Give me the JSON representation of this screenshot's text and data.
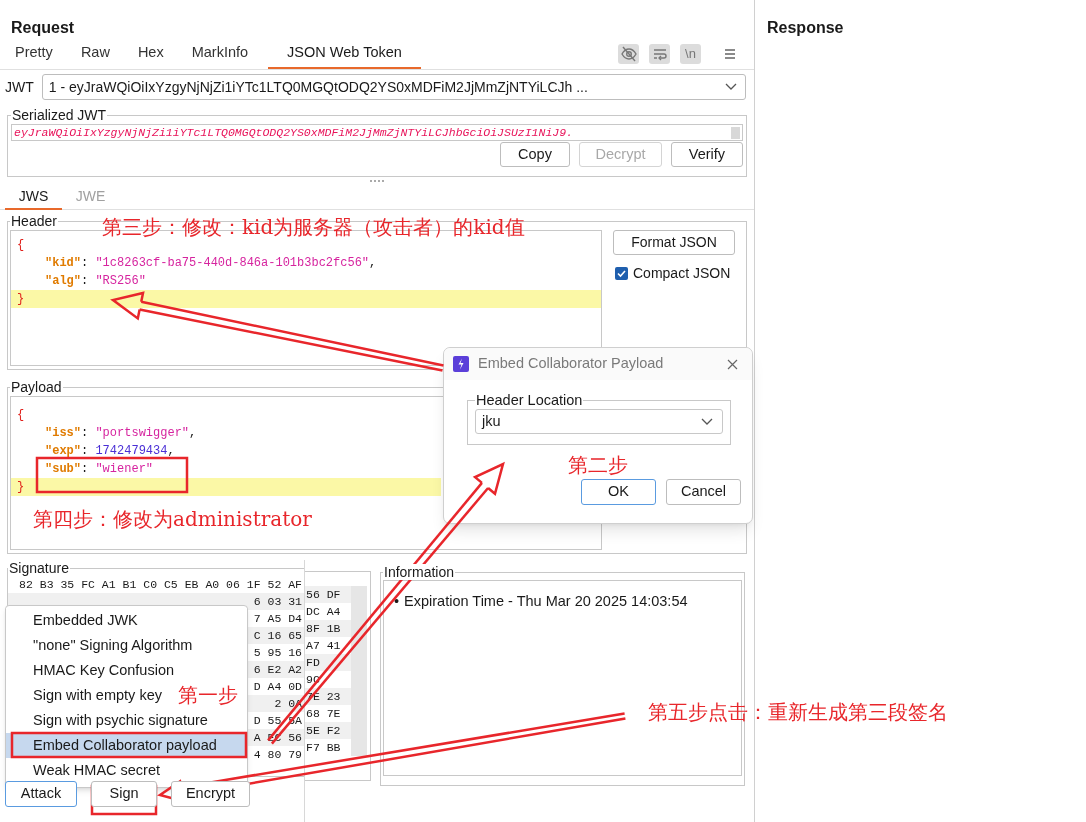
{
  "request": {
    "title": "Request",
    "tabs": [
      {
        "label": "Pretty",
        "selected": false
      },
      {
        "label": "Raw",
        "selected": false
      },
      {
        "label": "Hex",
        "selected": false
      },
      {
        "label": "MarkInfo",
        "selected": false
      },
      {
        "label": "JSON Web Token",
        "selected": true
      }
    ],
    "toolbar": [
      {
        "kind": "hide",
        "on": true
      },
      {
        "kind": "wrap",
        "on": true
      },
      {
        "kind": "newline",
        "label": "\\n",
        "on": true
      },
      {
        "kind": "menu",
        "on": false
      }
    ]
  },
  "jwt_selector": {
    "label": "JWT",
    "value": "1 - eyJraWQiOiIxYzgyNjNjZi1iYTc1LTQ0MGQtODQ2YS0xMDFiM2JjMmZjNTYiLCJh ..."
  },
  "serialized_jwt": {
    "title": "Serialized JWT",
    "value": "eyJraWQiOiIxYzgyNjNjZi1iYTc1LTQ0MGQtODQ2YS0xMDFiM2JjMmZjNTYiLCJhbGciOiJSUzI1NiJ9.",
    "buttons": [
      {
        "label": "Copy",
        "disabled": false
      },
      {
        "label": "Decrypt",
        "disabled": true
      },
      {
        "label": "Verify",
        "disabled": false
      }
    ]
  },
  "token_tabs": [
    {
      "label": "JWS",
      "selected": true
    },
    {
      "label": "JWE",
      "selected": false
    }
  ],
  "header": {
    "title": "Header",
    "lines": [
      {
        "kind": "brace",
        "text": "{",
        "highlighted": false
      },
      {
        "kind": "string",
        "key": "\"kid\"",
        "sep": ": ",
        "value": "\"1c8263cf-ba75-440d-846a-101b3bc2fc56\"",
        "tail": ",",
        "highlighted": false
      },
      {
        "kind": "string",
        "key": "\"alg\"",
        "sep": ": ",
        "value": "\"RS256\"",
        "highlighted": false
      },
      {
        "kind": "brace",
        "text": "}",
        "highlighted": true
      }
    ],
    "format_button": "Format JSON",
    "compact_json": {
      "label": "Compact JSON",
      "checked": true
    }
  },
  "payload": {
    "title": "Payload",
    "lines": [
      {
        "kind": "brace",
        "text": "{",
        "highlighted": false
      },
      {
        "kind": "string",
        "key": "\"iss\"",
        "sep": ": ",
        "value": "\"portswigger\"",
        "tail": ",",
        "highlighted": false
      },
      {
        "kind": "number",
        "key": "\"exp\"",
        "sep": ": ",
        "value": "1742479434",
        "tail": ",",
        "highlighted": false
      },
      {
        "kind": "string",
        "key": "\"sub\"",
        "sep": ": ",
        "value": "\"wiener\"",
        "highlighted": false
      },
      {
        "kind": "brace",
        "text": "}",
        "highlighted": true
      }
    ]
  },
  "signature": {
    "title": "Signature",
    "rows": [
      "82 B3 35 FC A1 B1 C0 C5 EB A0 06 1F 52 AF",
      "6 03 31",
      "7 A5 D4",
      "C 16 65",
      "5 95 16",
      "6 E2 A2",
      "D A4 0D",
      "2 0A",
      "D 55 5A",
      "A EC 56",
      "4 80 79"
    ],
    "back_rows": [
      "56 DF",
      "DC A4",
      "8F 1B",
      "A7 41",
      "FD",
      "9C",
      "7E 23",
      "68 7E",
      "5E F2",
      "F7 BB"
    ],
    "buttons": [
      {
        "label": "Attack",
        "active": true
      },
      {
        "label": "Sign",
        "active": false
      },
      {
        "label": "Encrypt",
        "active": false
      }
    ]
  },
  "attack_menu": {
    "items": [
      {
        "label": "Embedded JWK",
        "selected": false
      },
      {
        "label": "\"none\" Signing Algorithm",
        "selected": false
      },
      {
        "label": "HMAC Key Confusion",
        "selected": false
      },
      {
        "label": "Sign with empty key",
        "selected": false
      },
      {
        "label": "Sign with psychic signature",
        "selected": false
      },
      {
        "label": "Embed Collaborator payload",
        "selected": true
      },
      {
        "label": "Weak HMAC secret",
        "selected": false
      }
    ]
  },
  "information": {
    "title": "Information",
    "items": [
      {
        "bullet": "•",
        "text": "Expiration Time - Thu Mar 20 2025 14:03:54"
      }
    ]
  },
  "response": {
    "title": "Response"
  },
  "dialog": {
    "title": "Embed Collaborator Payload",
    "field": {
      "label": "Header Location",
      "value": "jku"
    },
    "buttons": [
      {
        "label": "OK",
        "default": true
      },
      {
        "label": "Cancel",
        "default": false
      }
    ]
  },
  "annotations": [
    {
      "text": "第三步：修改：kid为服务器（攻击者）的kid值"
    },
    {
      "text": "第二步"
    },
    {
      "text": "第四步：修改为administrator"
    },
    {
      "text": "第一步"
    },
    {
      "text": "第五步点击：重新生成第三段签名"
    }
  ]
}
